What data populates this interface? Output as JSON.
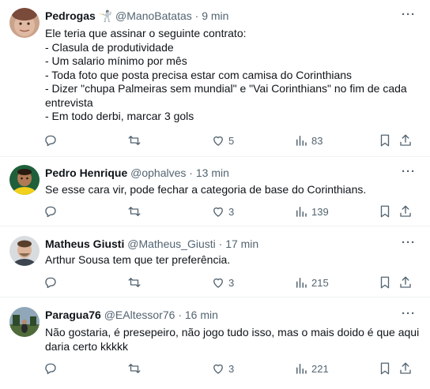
{
  "tweets": [
    {
      "name": "Pedrogas",
      "badge": "🤺",
      "handle": "@ManoBatatas",
      "sep": "·",
      "time": "9 min",
      "lines": [
        "Ele teria que assinar o seguinte contrato:",
        "- Clasula de produtividade",
        "- Um salario mínimo por mês",
        "- Toda foto que posta precisa estar com camisa do Corinthians",
        "- Dizer \"chupa Palmeiras sem mundial\" e \"Vai Corinthians\" no fim de cada",
        "entrevista",
        "- Em todo derbi, marcar 3 gols"
      ],
      "likes": "5",
      "views": "83"
    },
    {
      "name": "Pedro Henrique",
      "badge": "",
      "handle": "@ophalves",
      "sep": "·",
      "time": "13 min",
      "lines": [
        "Se esse cara vir, pode fechar a categoria de base do Corinthians."
      ],
      "likes": "3",
      "views": "139"
    },
    {
      "name": "Matheus Giusti",
      "badge": "",
      "handle": "@Matheus_Giusti",
      "sep": "·",
      "time": "17 min",
      "lines": [
        "Arthur Sousa tem que ter preferência."
      ],
      "likes": "3",
      "views": "215"
    },
    {
      "name": "Paragua76",
      "badge": "",
      "handle": "@EAltessor76",
      "sep": "·",
      "time": "16 min",
      "lines": [
        "Não gostaria, é presepeiro, não jogo tudo isso, mas o mais doido é que aqui",
        "daria certo kkkkk"
      ],
      "likes": "3",
      "views": "221"
    }
  ],
  "icons": {
    "more": "more-icon",
    "reply": "reply-icon",
    "retweet": "retweet-icon",
    "like": "like-icon",
    "views": "views-icon",
    "bookmark": "bookmark-icon",
    "share": "share-icon"
  },
  "colors": {
    "text": "#0f1419",
    "muted": "#536471",
    "divider": "#eff3f4"
  }
}
